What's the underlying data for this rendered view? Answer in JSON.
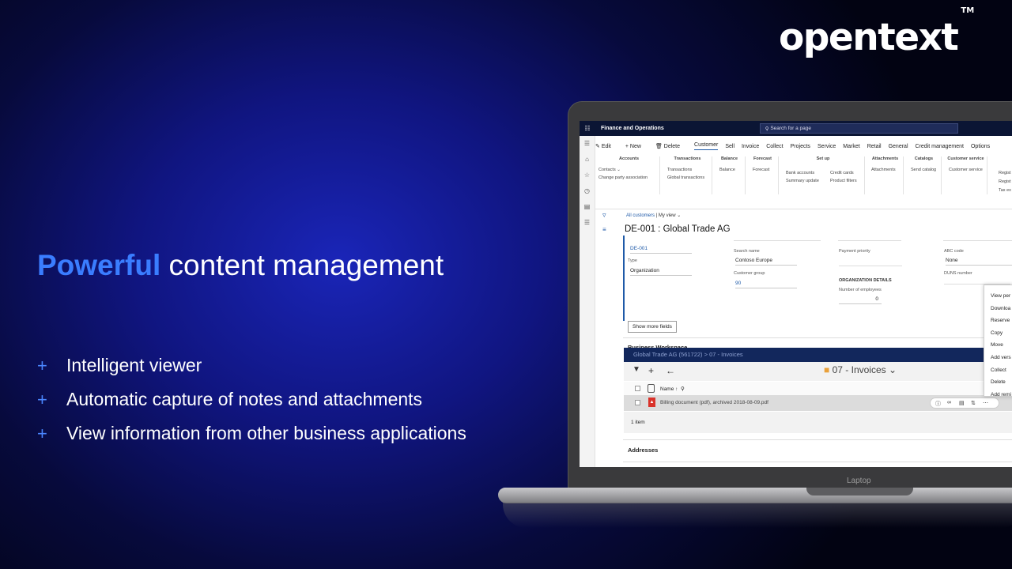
{
  "brand": {
    "logo": "opentext",
    "trademark": "TM"
  },
  "headline": {
    "accent": "Powerful",
    "rest": " content management"
  },
  "bullets": [
    "Intelligent viewer",
    "Automatic capture of notes and attachments",
    "View information from other business applications"
  ],
  "laptop_label": "Laptop",
  "app": {
    "name": "Finance and Operations",
    "search_placeholder": "Search for a page",
    "actions": [
      "Edit",
      "New",
      "Delete",
      "Customer",
      "Sell",
      "Invoice",
      "Collect",
      "Projects",
      "Service",
      "Market",
      "Retail",
      "General",
      "Credit management",
      "Options"
    ],
    "ribbon": {
      "accounts": {
        "title": "Accounts",
        "items": [
          "Contacts",
          "Change party association"
        ]
      },
      "transactions": {
        "title": "Transactions",
        "items": [
          "Transactions",
          "Global transactions"
        ]
      },
      "balance": {
        "title": "Balance",
        "items": [
          "Balance"
        ]
      },
      "forecast": {
        "title": "Forecast",
        "items": [
          "Forecast"
        ]
      },
      "setup": {
        "title": "Set up",
        "col1": [
          "Bank accounts",
          "Summary update"
        ],
        "col2": [
          "Credit cards",
          "Product filters"
        ]
      },
      "attachments": {
        "title": "Attachments",
        "items": [
          "Attachments"
        ]
      },
      "catalogs": {
        "title": "Catalogs",
        "items": [
          "Send catalog"
        ]
      },
      "customer_service": {
        "title": "Customer service",
        "items": [
          "Customer service"
        ]
      },
      "overflow": [
        "Regist",
        "Regist",
        "Tax ex"
      ]
    },
    "breadcrumb": {
      "link": "All customers",
      "separator": "|",
      "view": "My view"
    },
    "record_title": "DE-001 : Global Trade AG",
    "fields": {
      "account": "DE-001",
      "type_label": "Type",
      "type_value": "Organization",
      "search_name_label": "Search name",
      "search_name_value": "Contoso Europe",
      "customer_group_label": "Customer group",
      "customer_group_value": "90",
      "payment_priority_label": "Payment priority",
      "org_details_label": "ORGANIZATION DETAILS",
      "employees_label": "Number of employees",
      "employees_value": "0",
      "abc_code_label": "ABC code",
      "abc_code_value": "None",
      "duns_label": "DUNS number"
    },
    "show_more": "Show more fields",
    "workspace": {
      "title": "Business Workspace",
      "path": "Global Trade AG (561722)  >  07 - Invoices",
      "folder": "07 - Invoices",
      "col_name": "Name",
      "row_file": "Billing document (pdf), archived 2018-08-09.pdf",
      "count": "1 item"
    },
    "context_menu": [
      "View per",
      "Downloa",
      "Reserve",
      "Copy",
      "Move",
      "Add vers",
      "Collect",
      "Delete",
      "Add remi"
    ],
    "addresses": "Addresses"
  }
}
